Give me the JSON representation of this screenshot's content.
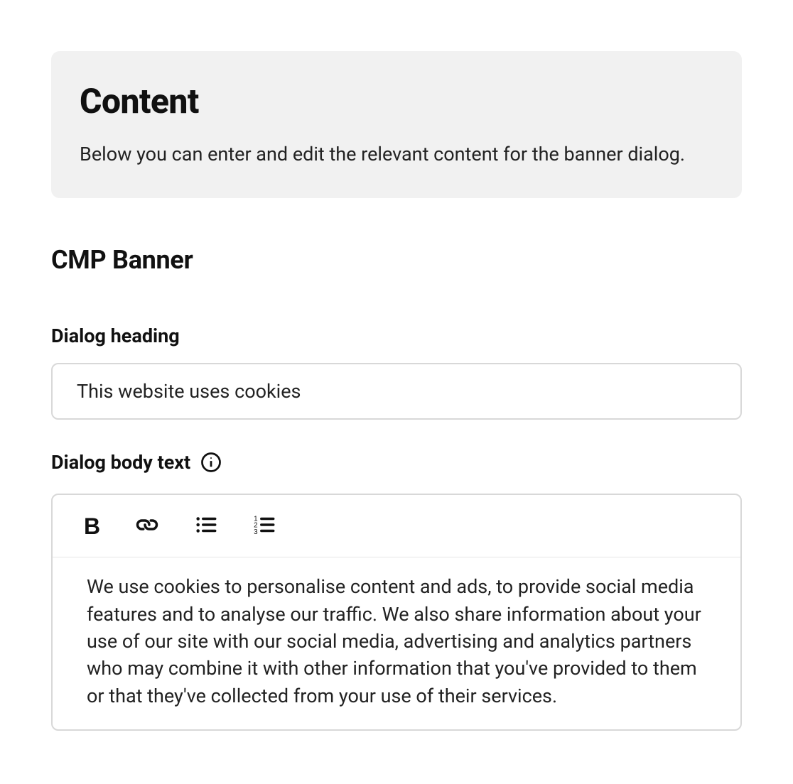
{
  "intro": {
    "title": "Content",
    "description": "Below you can enter and edit the relevant content for the banner dialog."
  },
  "section": {
    "title": "CMP Banner"
  },
  "fields": {
    "heading": {
      "label": "Dialog heading",
      "value": "This website uses cookies"
    },
    "body": {
      "label": "Dialog body text",
      "value": "We use cookies to personalise content and ads, to provide social media features and to analyse our traffic. We also share information about your use of our site with our social media, advertising and analytics partners who may combine it with other information that you've provided to them or that they've collected from your use of their services."
    }
  },
  "toolbar": {
    "bold": "B"
  }
}
